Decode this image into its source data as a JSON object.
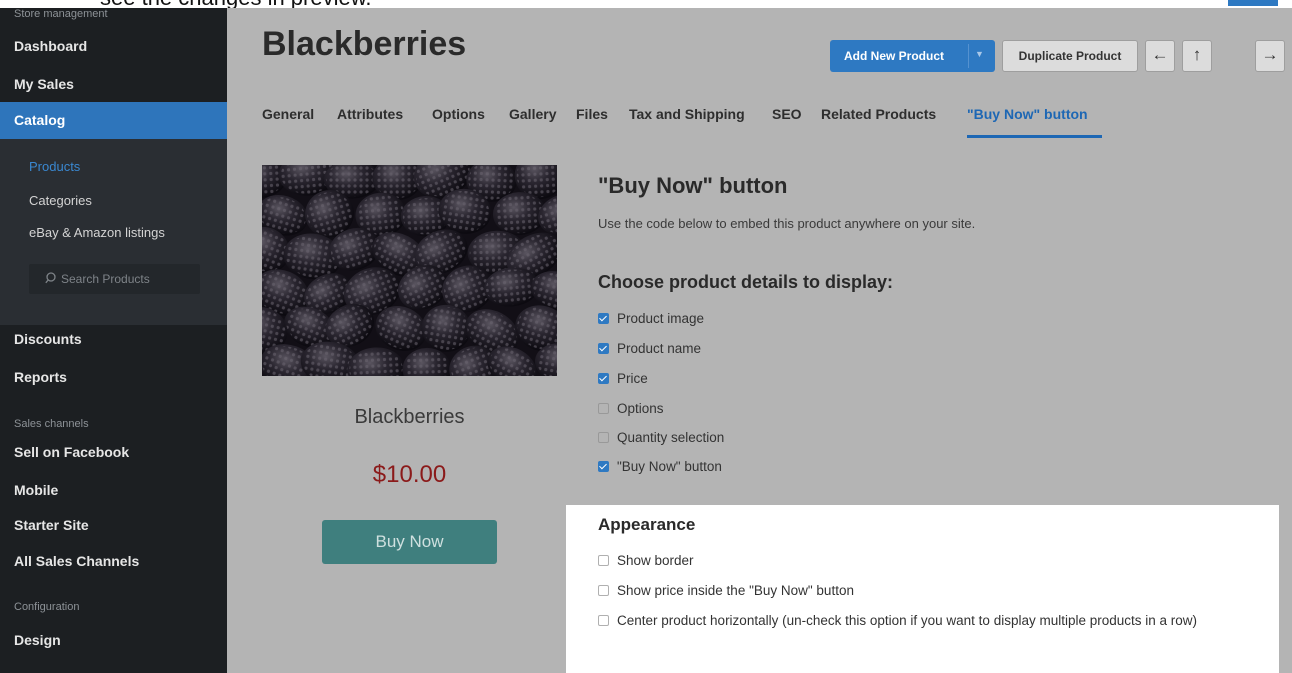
{
  "caption": "see the changes in preview.",
  "sidebar": {
    "section_store": "Store management",
    "dashboard": "Dashboard",
    "my_sales": "My Sales",
    "catalog": "Catalog",
    "sub_items": [
      "Products",
      "Categories",
      "eBay & Amazon listings"
    ],
    "search_placeholder": "Search Products",
    "discounts": "Discounts",
    "reports": "Reports",
    "section_channels": "Sales channels",
    "sell_on_facebook": "Sell on Facebook",
    "mobile": "Mobile",
    "starter_site": "Starter Site",
    "all_sales_channels": "All Sales Channels",
    "section_config": "Configuration",
    "design": "Design"
  },
  "header": {
    "title": "Blackberries",
    "add_new_product": "Add New Product",
    "duplicate_product": "Duplicate Product",
    "arrow_left": "←",
    "arrow_up": "↑",
    "arrow_right": "→"
  },
  "tabs": [
    "General",
    "Attributes",
    "Options",
    "Gallery",
    "Files",
    "Tax and Shipping",
    "SEO",
    "Related Products",
    "\"Buy Now\" button"
  ],
  "preview": {
    "name": "Blackberries",
    "price": "$10.00",
    "buy_label": "Buy Now"
  },
  "content": {
    "heading": "\"Buy Now\" button",
    "description": "Use the code below to embed this product anywhere on your site.",
    "choose_heading": "Choose product details to display:",
    "options": [
      {
        "label": "Product image",
        "checked": true
      },
      {
        "label": "Product name",
        "checked": true
      },
      {
        "label": "Price",
        "checked": true
      },
      {
        "label": "Options",
        "checked": false
      },
      {
        "label": "Quantity selection",
        "checked": false
      },
      {
        "label": "\"Buy Now\" button",
        "checked": true
      }
    ],
    "appearance_heading": "Appearance",
    "appearance_options": [
      {
        "label": "Show border",
        "checked": false
      },
      {
        "label": "Show price inside the \"Buy Now\" button",
        "checked": false
      },
      {
        "label": "Center product horizontally (un-check this option if you want to display multiple products in a row)",
        "checked": false
      }
    ]
  },
  "colors": {
    "accent": "#2e79c2",
    "sidebar_bg": "#1c1f22",
    "main_overlay": "#b4b4b4",
    "price": "#8b1a1a",
    "buy_button": "#3f7f7e"
  }
}
